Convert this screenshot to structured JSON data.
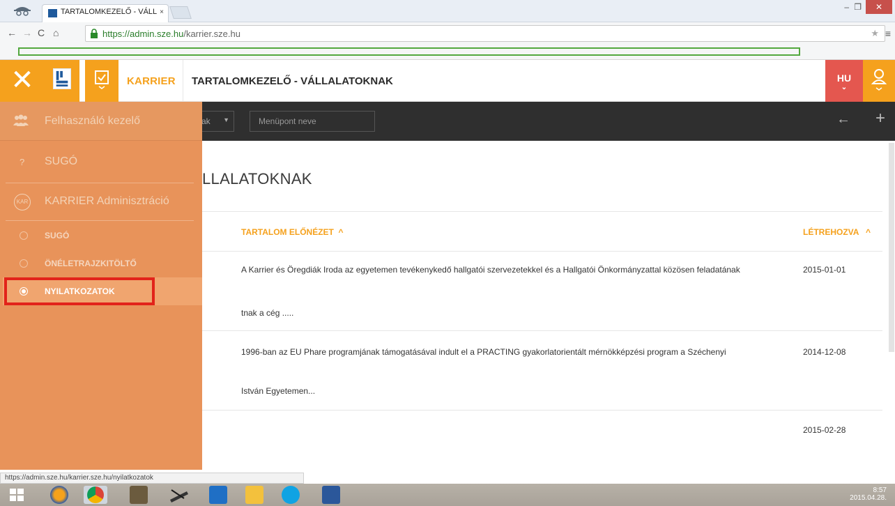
{
  "browser": {
    "tab_title": "TARTALOMKEZELŐ - VÁLL",
    "tab_close": "×",
    "url_host": "https://admin.sze.hu",
    "url_path": "/karrier.sze.hu",
    "status_url": "https://admin.sze.hu/karrier.sze.hu/nyilatkozatok"
  },
  "header": {
    "close_label": "✕",
    "module_label": "KARRIER",
    "page_title": "TARTALOMKEZELŐ - VÁLLALATOKNAK",
    "lang": "HU",
    "lang_chevron": "⌄"
  },
  "toolbar": {
    "filter_visible_text": "ak",
    "search_placeholder": "Menüpont neve"
  },
  "main": {
    "section_title": "LLALATOKNAK",
    "columns": {
      "preview": "TARTALOM ELŐNÉZET",
      "created": "LÉTREHOZVA"
    },
    "rows": [
      {
        "line1": "A Karrier és Öregdiák Iroda az egyetemen tevékenykedő hallgatói szervezetekkel és a Hallgatói Önkormányzattal közösen feladatának",
        "line2": "tnak a cég .....",
        "date": "2015-01-01"
      },
      {
        "line1": "1996-ban az EU Phare programjának támogatásával indult el a PRACTING gyakorlatorientált mérnökképzési program a Széchenyi",
        "line2": "István Egyetemen...",
        "date": "2014-12-08"
      },
      {
        "line1": "",
        "line2": "",
        "date": "2015-02-28"
      }
    ]
  },
  "sidebar": {
    "user_manager": "Felhasználó kezelő",
    "help_icon": "?",
    "help": "SUGÓ",
    "kar_badge": "KAR",
    "karrier_admin": "KARRIER Adminisztráció",
    "sub_items": [
      {
        "label": "SUGÓ"
      },
      {
        "label": "ÖNÉLETRAJZKITÖLTŐ"
      },
      {
        "label": "NYILATKOZATOK"
      }
    ]
  },
  "taskbar": {
    "time": "8:57",
    "date": "2015.04.28."
  },
  "colors": {
    "accent": "#f5a11d",
    "sidebar": "#e8935a",
    "lang": "#e4574f",
    "highlight": "#e2231a"
  }
}
